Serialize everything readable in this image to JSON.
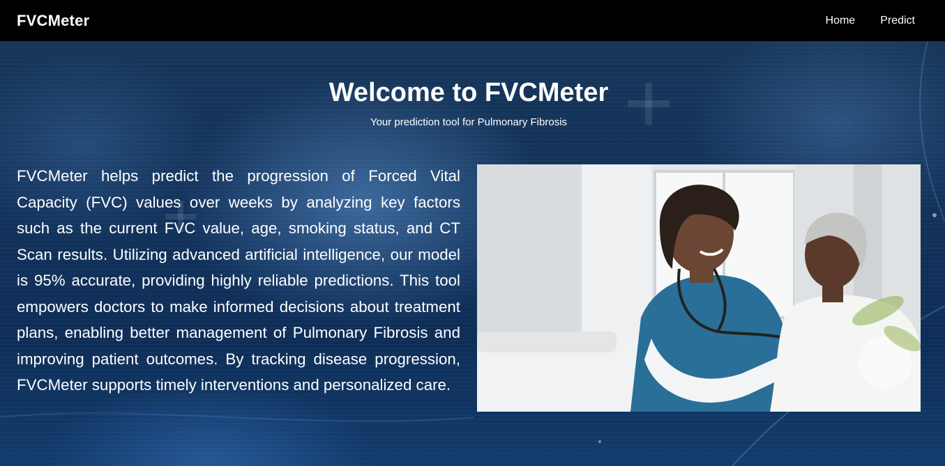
{
  "navbar": {
    "brand": "FVCMeter",
    "links": [
      {
        "label": "Home"
      },
      {
        "label": "Predict"
      }
    ]
  },
  "hero": {
    "title": "Welcome to FVCMeter",
    "subtitle": "Your prediction tool for Pulmonary Fibrosis",
    "description": "FVCMeter helps predict the progression of Forced Vital Capacity (FVC) values over weeks by analyzing key factors such as the current FVC value, age, smoking status, and CT Scan results. Utilizing advanced artificial intelligence, our model is 95% accurate, providing highly reliable predictions. This tool empowers doctors to make informed decisions about treatment plans, enabling better management of Pulmonary Fibrosis and improving patient outcomes. By tracking disease progression, FVCMeter supports timely interventions and personalized care.",
    "image": {
      "subject": "nurse-examining-elderly-patient-photo"
    }
  },
  "colors": {
    "navbar_bg": "#000000",
    "hero_bg": "#12325b",
    "text": "#ffffff",
    "scrub_blue": "#2a6f97"
  }
}
